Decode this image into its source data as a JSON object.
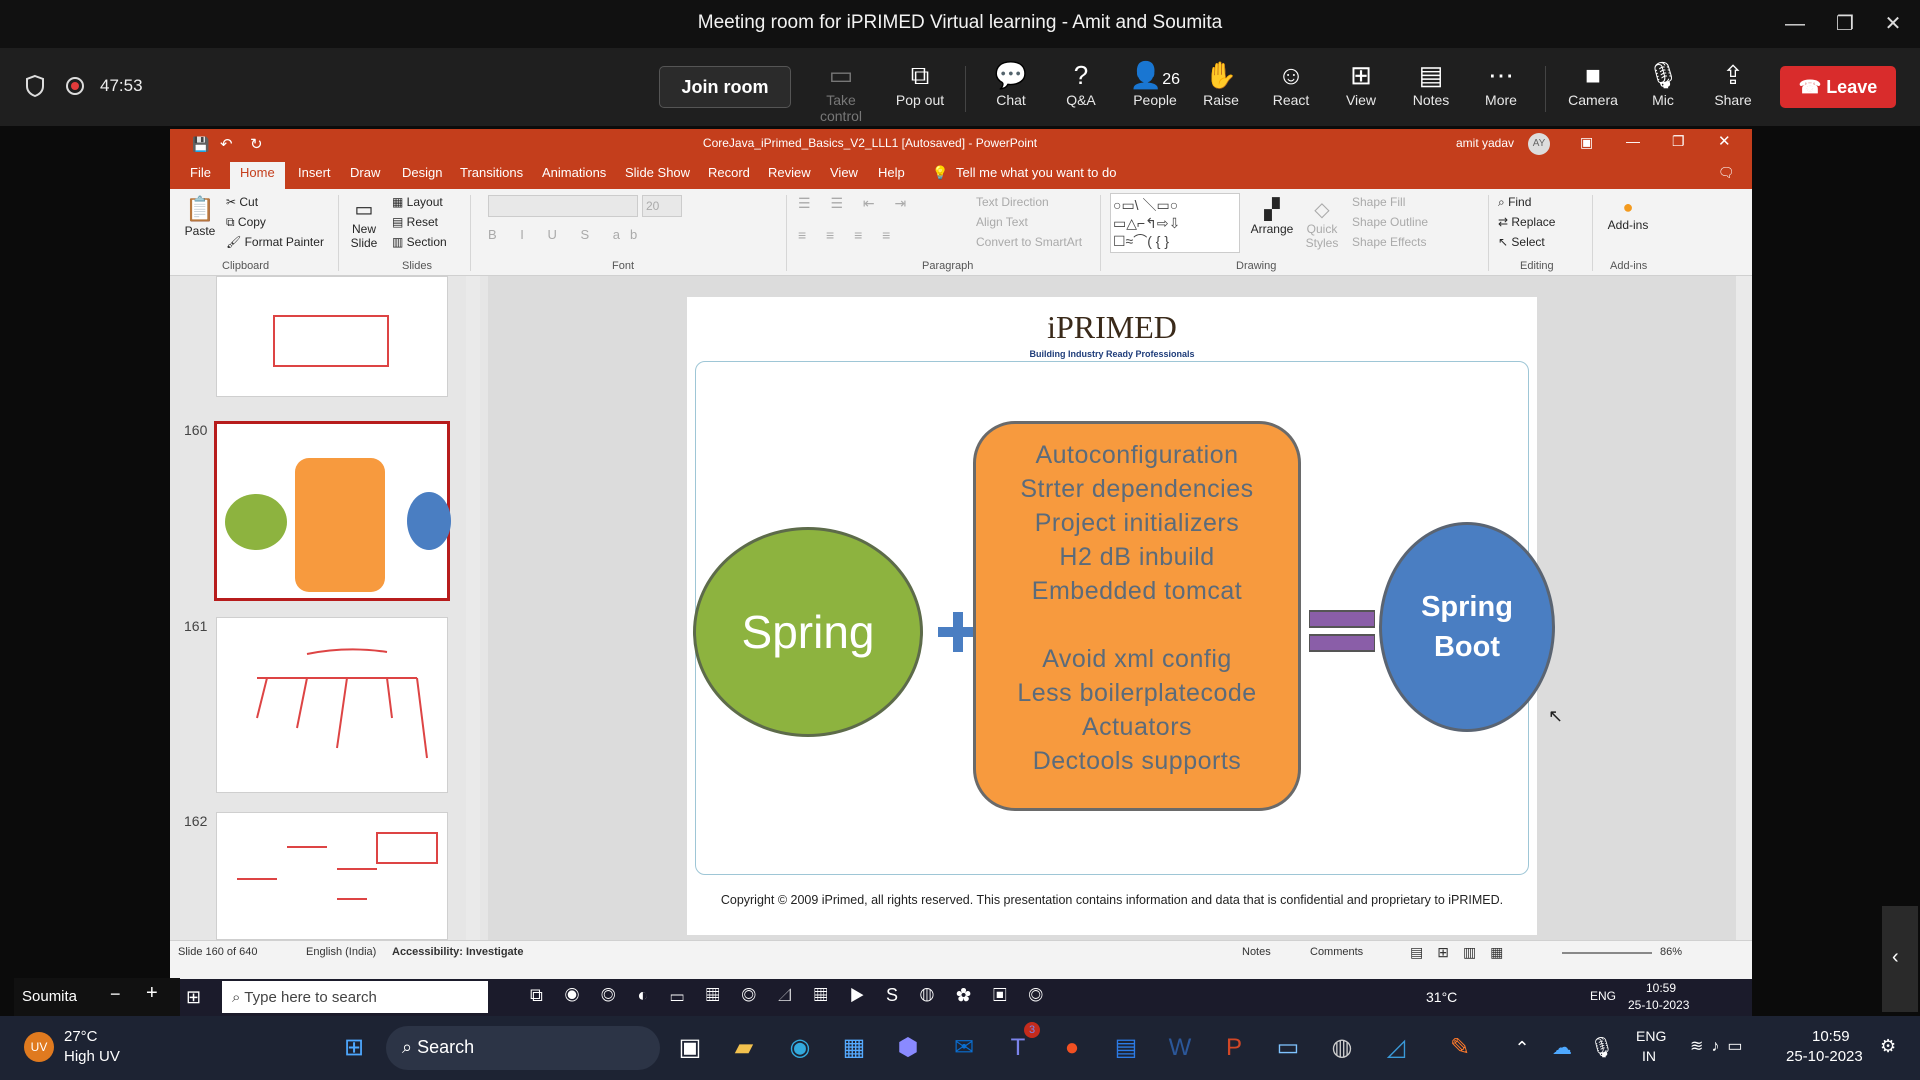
{
  "window": {
    "title": "Meeting room for iPRIMED Virtual learning - Amit and Soumita",
    "minimize": "—",
    "restore": "❐",
    "close": "✕"
  },
  "meeting": {
    "timer": "47:53"
  },
  "toolbar": {
    "join_room": "Join room",
    "take_control": "Take control",
    "pop_out": "Pop out",
    "chat": "Chat",
    "qa": "Q&A",
    "people": "People",
    "people_count": "26",
    "raise": "Raise",
    "react": "React",
    "view": "View",
    "notes": "Notes",
    "more": "More",
    "camera": "Camera",
    "mic": "Mic",
    "share": "Share",
    "leave": "Leave"
  },
  "ppt": {
    "title": "CoreJava_iPrimed_Basics_V2_LLL1 [Autosaved]  -  PowerPoint",
    "user": "amit yadav",
    "user_initials": "AY",
    "tabs": [
      "File",
      "Home",
      "Insert",
      "Draw",
      "Design",
      "Transitions",
      "Animations",
      "Slide Show",
      "Record",
      "Review",
      "View",
      "Help"
    ],
    "tell_me": "Tell me what you want to do",
    "ribbon": {
      "clipboard": {
        "paste": "Paste",
        "cut": "Cut",
        "copy": "Copy",
        "format_painter": "Format Painter",
        "label": "Clipboard"
      },
      "slides": {
        "new_slide": "New Slide",
        "layout": "Layout",
        "reset": "Reset",
        "section": "Section",
        "label": "Slides"
      },
      "font": {
        "size": "20",
        "label": "Font"
      },
      "paragraph": {
        "text_direction": "Text Direction",
        "align_text": "Align Text",
        "convert": "Convert to SmartArt",
        "label": "Paragraph"
      },
      "drawing": {
        "arrange": "Arrange",
        "quick_styles": "Quick Styles",
        "shape_fill": "Shape Fill",
        "shape_outline": "Shape Outline",
        "shape_effects": "Shape Effects",
        "label": "Drawing"
      },
      "editing": {
        "find": "Find",
        "replace": "Replace",
        "select": "Select",
        "label": "Editing"
      },
      "addins": {
        "addins": "Add-ins",
        "label": "Add-ins"
      }
    },
    "thumbnails": [
      {
        "num": ""
      },
      {
        "num": "160"
      },
      {
        "num": "161"
      },
      {
        "num": "162"
      }
    ],
    "slide": {
      "logo": "iPRIMED",
      "tagline": "Building Industry Ready Professionals",
      "spring": "Spring",
      "features": [
        "Autoconfiguration",
        "Strter dependencies",
        "Project initializers",
        "H2 dB inbuild",
        "Embedded tomcat",
        "",
        "Avoid xml config",
        "Less boilerplatecode",
        "Actuators",
        "Dectools supports"
      ],
      "result_line1": "Spring",
      "result_line2": "Boot",
      "footer": "Copyright © 2009 iPrimed, all rights reserved. This presentation contains information  and data  that is confidential and proprietary to iPRIMED."
    },
    "status": {
      "slide": "Slide 160 of 640",
      "language": "English (India)",
      "accessibility": "Accessibility: Investigate",
      "notes": "Notes",
      "comments": "Comments",
      "zoom": "86%"
    }
  },
  "inner_taskbar": {
    "search": "Type here to search",
    "temp": "31°C",
    "lang": "ENG",
    "time": "10:59",
    "date": "25-10-2023"
  },
  "presenter": {
    "name": "Soumita"
  },
  "taskbar": {
    "weather_temp": "27°C",
    "weather_desc": "High UV",
    "search": "Search",
    "lang1": "ENG",
    "lang2": "IN",
    "time": "10:59",
    "date": "25-10-2023",
    "teams_badge": "3"
  },
  "colors": {
    "ppt_red": "#c43e1c",
    "spring_green": "#8db33f",
    "box_orange": "#f79a3e",
    "boot_blue": "#4a7ec2",
    "leave_red": "#d92c2c"
  }
}
